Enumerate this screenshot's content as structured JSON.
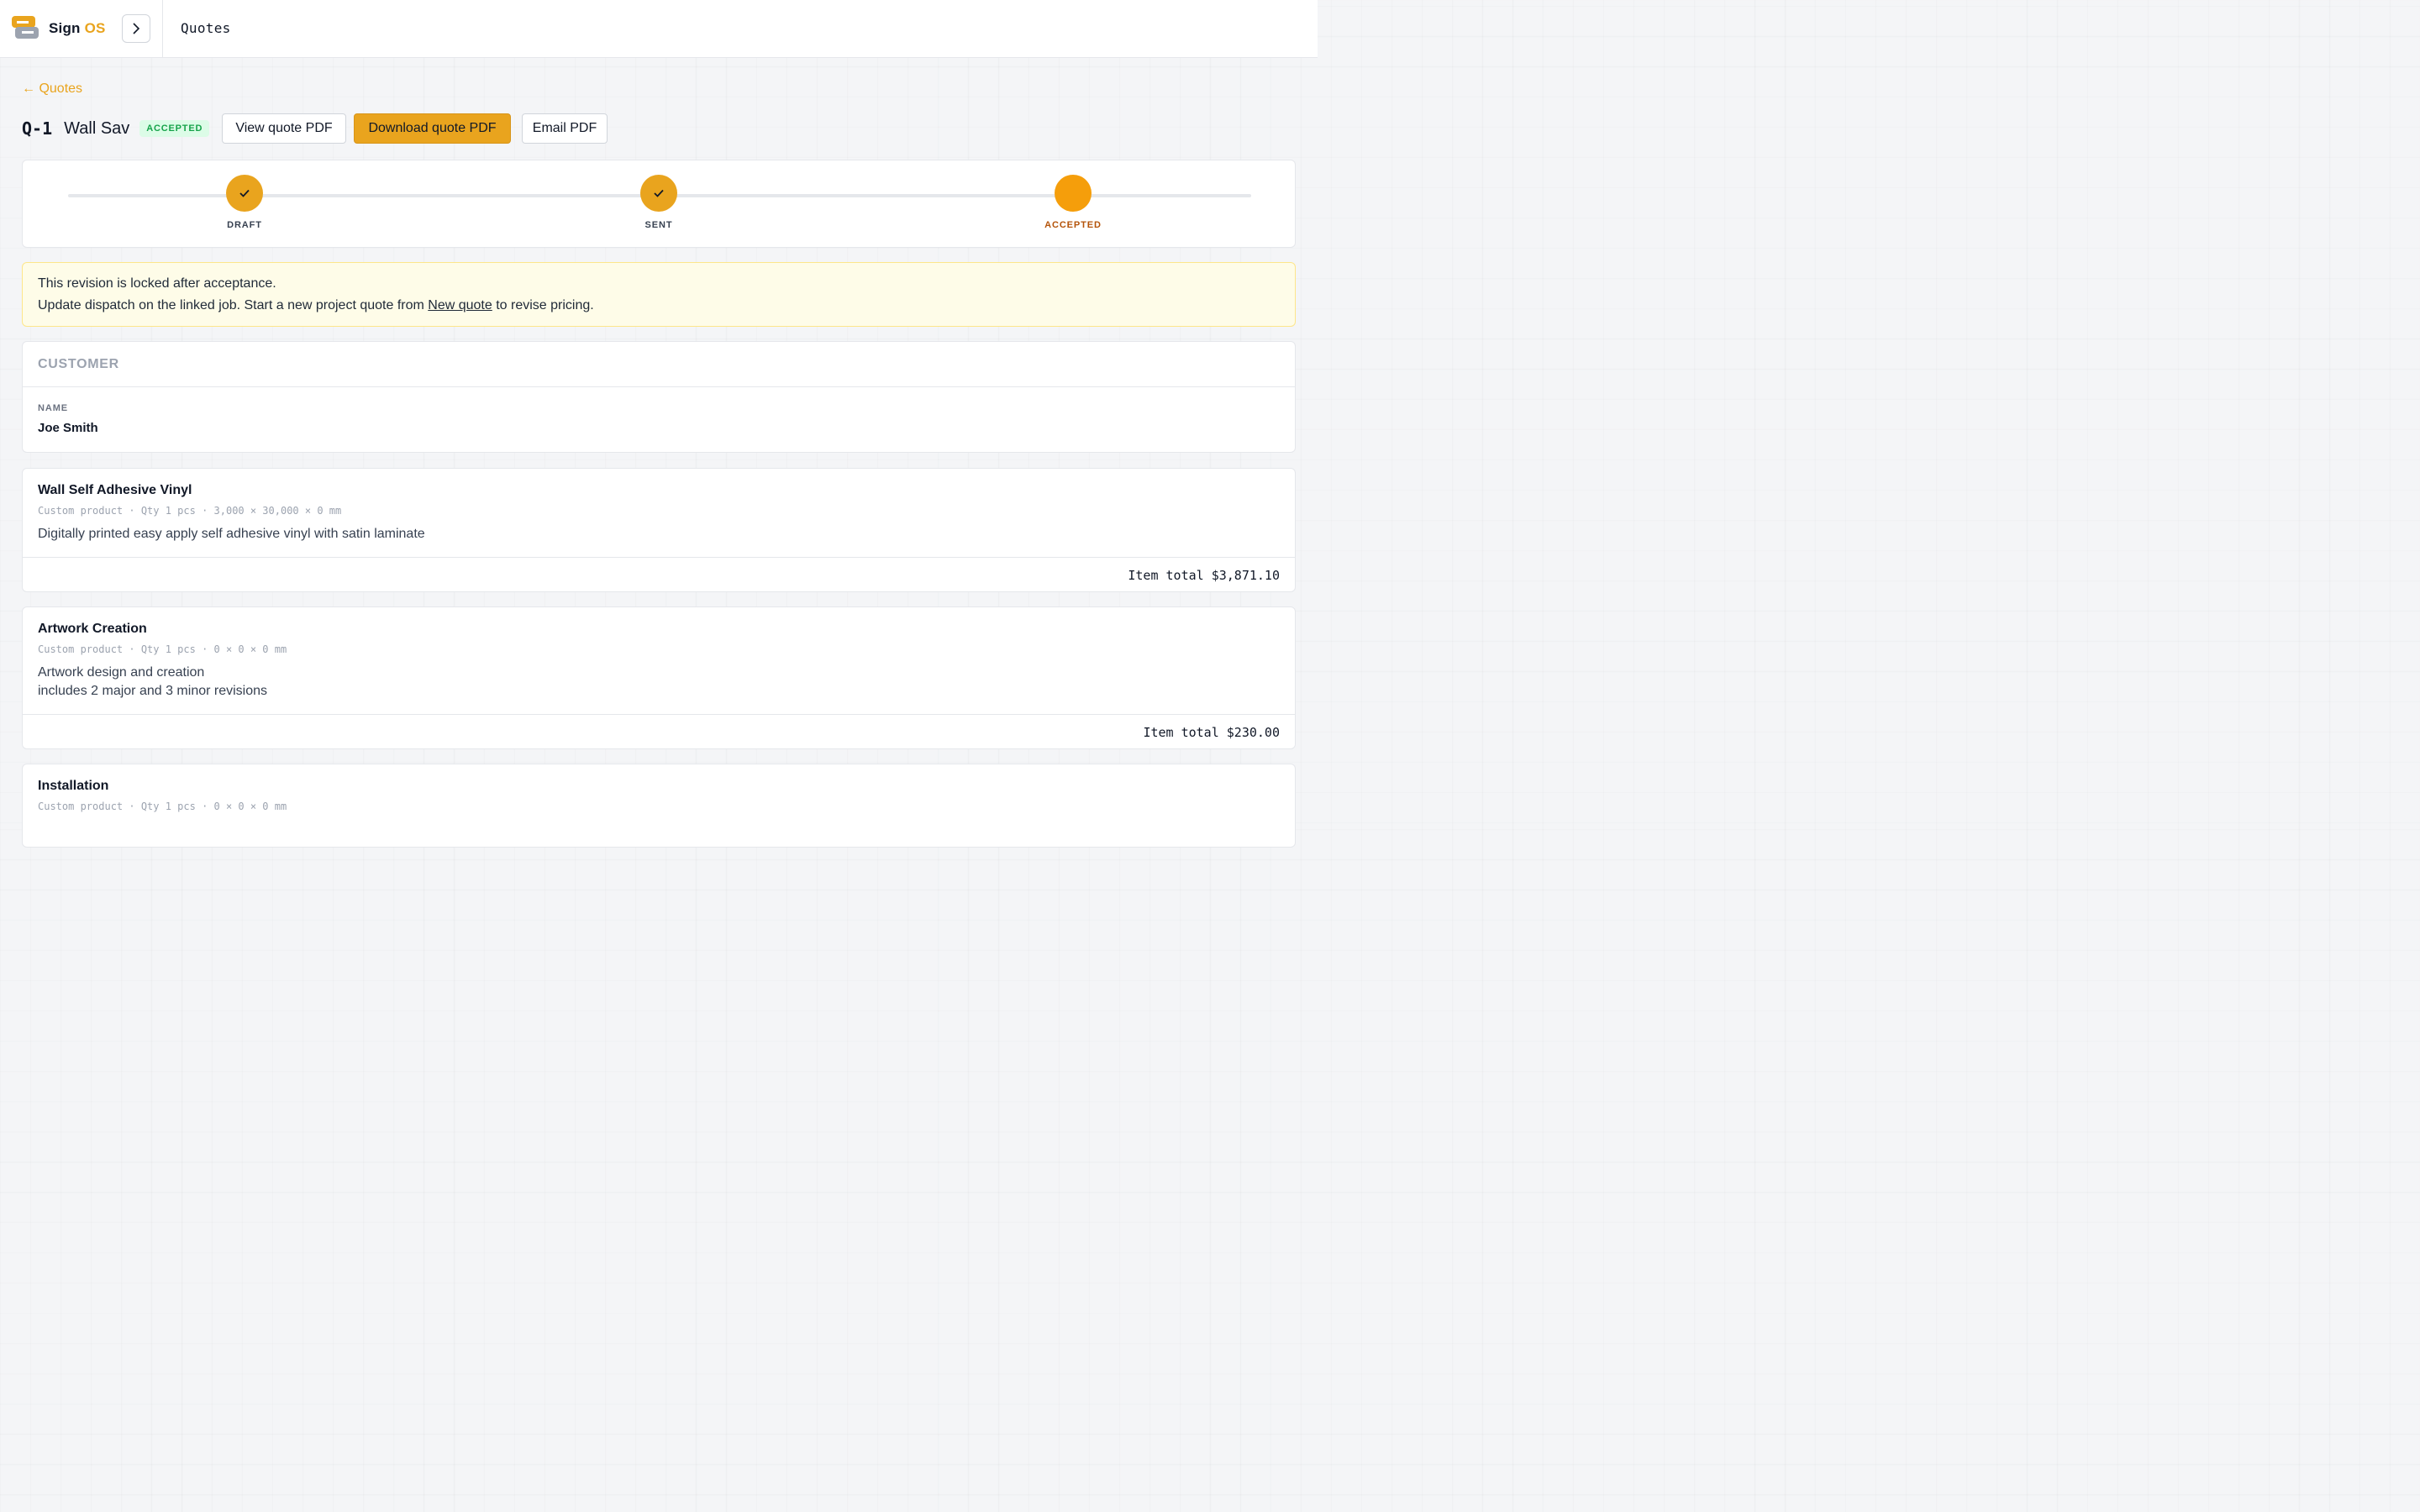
{
  "brand": {
    "name_part1": "Sign",
    "name_part2": "OS",
    "accent": "#e9a41e"
  },
  "header": {
    "title": "Quotes"
  },
  "breadcrumb": {
    "back_label": "← Quotes"
  },
  "quote": {
    "number": "Q-1",
    "name": "Wall Sav",
    "status": "ACCEPTED",
    "status_color": "#16a34a"
  },
  "actions": {
    "view_pdf": "View quote PDF",
    "download_pdf": "Download quote PDF",
    "email_pdf": "Email PDF"
  },
  "progress": {
    "steps": [
      {
        "label": "DRAFT",
        "state": "done",
        "icon": "check-icon"
      },
      {
        "label": "SENT",
        "state": "done",
        "icon": "check-icon"
      },
      {
        "label": "ACCEPTED",
        "state": "current"
      }
    ]
  },
  "alert": {
    "title": "This revision is locked after acceptance.",
    "body_before": "Update dispatch on the linked job. Start a new project quote from ",
    "link": "New quote",
    "body_after": " to revise pricing."
  },
  "customer": {
    "heading": "CUSTOMER",
    "name_label": "NAME",
    "name": "Joe Smith"
  },
  "line_items": [
    {
      "title": "Wall Self Adhesive Vinyl",
      "meta": "Custom product · Qty 1 pcs · 3,000 × 30,000 × 0 mm",
      "description": [
        "Digitally printed easy apply self adhesive vinyl with satin laminate"
      ],
      "total": "Item total $3,871.10"
    },
    {
      "title": "Artwork Creation",
      "meta": "Custom product · Qty 1 pcs · 0 × 0 × 0 mm",
      "description": [
        "Artwork design and creation",
        "includes 2 major and 3 minor revisions"
      ],
      "total": "Item total $230.00"
    },
    {
      "title": "Installation",
      "meta": "Custom product · Qty 1 pcs · 0 × 0 × 0 mm"
    }
  ]
}
